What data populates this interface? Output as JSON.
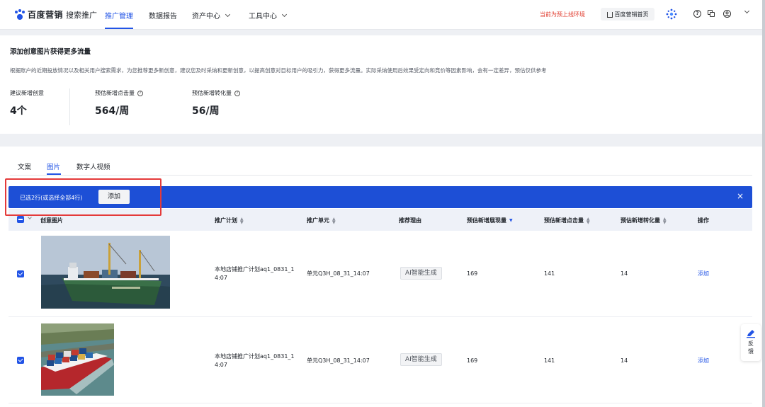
{
  "brand": {
    "logo": "百度营销",
    "sub": "搜索推广"
  },
  "nav": {
    "items": [
      {
        "label": "推广管理",
        "active": true
      },
      {
        "label": "数据报告"
      },
      {
        "label": "资产中心"
      },
      {
        "label": "工具中心"
      }
    ],
    "env_notice": "当前为预上线环境",
    "home_button": "百度营销首页",
    "icons": [
      "help-icon",
      "copy-icon",
      "user-icon",
      "chevron-down-icon"
    ]
  },
  "summary": {
    "title": "添加创意图片获得更多流量",
    "description": "根据账户的近期投放情况以及相关用户搜索需求，为您推荐更多新创意，建议您及时采纳和更新创意，以提高创意对目标用户的吸引力，获得更多流量。实际采纳使用后效果受定向和竞价等因素影响，会有一定差异，预估仅供参考",
    "metrics": [
      {
        "label": "建议新增创意",
        "value": "4个"
      },
      {
        "label": "预估新增点击量",
        "value": "564/周"
      },
      {
        "label": "预估新增转化量",
        "value": "56/周"
      }
    ]
  },
  "tabs": [
    {
      "label": "文案"
    },
    {
      "label": "图片",
      "active": true
    },
    {
      "label": "数字人视频"
    }
  ],
  "selection_bar": {
    "text": "已选2行(或选择全部4行)",
    "add_label": "添加",
    "close": "×"
  },
  "table": {
    "headers": [
      "创意图片",
      "推广计划",
      "推广单元",
      "推荐理由",
      "预估新增展现量",
      "预估新增点击量",
      "预估新增转化量",
      "操作"
    ],
    "rows": [
      {
        "plan_line1": "本地店铺推广计划aq1_0831_1",
        "plan_line2": "4:07",
        "unit": "单元Q3H_08_31_14:07",
        "reason": "AI智能生成",
        "impressions": "169",
        "clicks": "141",
        "conversions": "14",
        "action": "添加"
      },
      {
        "plan_line1": "本地店铺推广计划aq1_0831_1",
        "plan_line2": "4:07",
        "unit": "单元Q3H_08_31_14:07",
        "reason": "AI智能生成",
        "impressions": "169",
        "clicks": "141",
        "conversions": "14",
        "action": "添加"
      }
    ]
  },
  "feedback": {
    "line1": "反",
    "line2": "馈"
  },
  "colors": {
    "accent": "#2254e6",
    "selection_bar": "#1d4fd6",
    "env_notice": "#e0392b",
    "highlight": "#e43a3a"
  }
}
